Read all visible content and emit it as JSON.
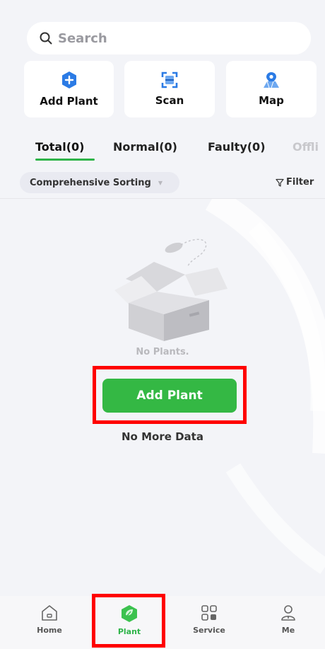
{
  "search": {
    "placeholder": "Search"
  },
  "quick_actions": [
    {
      "label": "Add Plant",
      "icon": "add-plant-icon"
    },
    {
      "label": "Scan",
      "icon": "scan-icon"
    },
    {
      "label": "Map",
      "icon": "map-icon"
    }
  ],
  "tabs": [
    "Total(0)",
    "Normal(0)",
    "Faulty(0)",
    "Offli"
  ],
  "sorting": {
    "label": "Comprehensive Sorting",
    "filter": "Filter"
  },
  "empty_state": {
    "message": "No Plants.",
    "button": "Add Plant",
    "footer": "No More Data"
  },
  "nav": [
    {
      "label": "Home",
      "icon": "home-icon"
    },
    {
      "label": "Plant",
      "icon": "plant-icon",
      "active": true
    },
    {
      "label": "Service",
      "icon": "service-icon"
    },
    {
      "label": "Me",
      "icon": "me-icon"
    }
  ],
  "colors": {
    "accent": "#34b844",
    "highlight": "#ff0000",
    "icon_blue": "#2b7be5"
  }
}
